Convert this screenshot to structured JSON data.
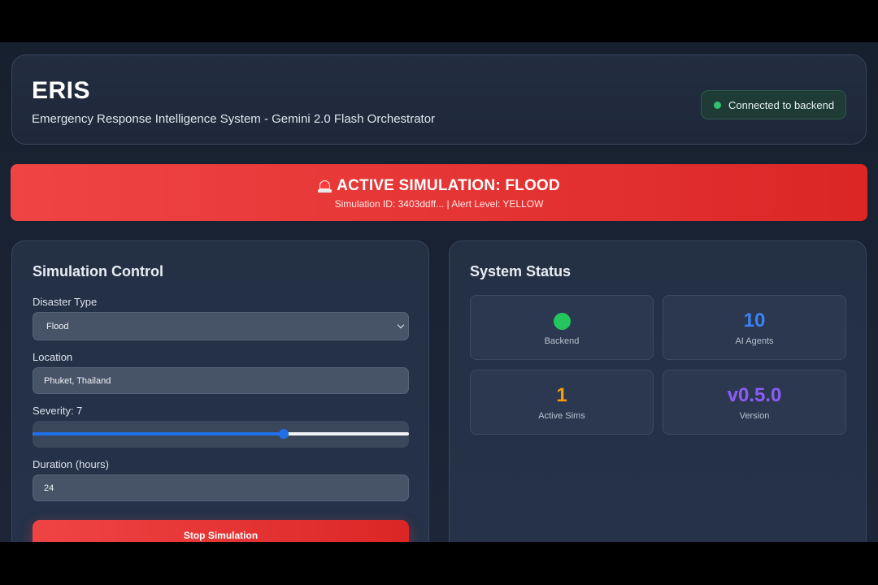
{
  "header": {
    "title": "ERIS",
    "subtitle": "Emergency Response Intelligence System - Gemini 2.0 Flash Orchestrator",
    "connection_status": "Connected to backend"
  },
  "alert": {
    "icon": "siren-icon",
    "title": "ACTIVE SIMULATION: FLOOD",
    "details": "Simulation ID: 3403ddff... | Alert Level: YELLOW"
  },
  "control": {
    "title": "Simulation Control",
    "disaster_type_label": "Disaster Type",
    "disaster_type_value": "Flood",
    "location_label": "Location",
    "location_value": "Phuket, Thailand",
    "severity_label": "Severity: 7",
    "severity_value": 7,
    "severity_min": 1,
    "severity_max": 10,
    "duration_label": "Duration (hours)",
    "duration_value": "24",
    "stop_button_label": "Stop Simulation"
  },
  "status": {
    "title": "System Status",
    "cards": [
      {
        "value": "",
        "label": "Backend",
        "indicator": "green-dot"
      },
      {
        "value": "10",
        "label": "AI Agents"
      },
      {
        "value": "1",
        "label": "Active Sims"
      },
      {
        "value": "v0.5.0",
        "label": "Version"
      }
    ]
  },
  "colors": {
    "accent_red": "#ef4444",
    "status_green": "#22c55e",
    "agents_blue": "#3b82f6",
    "sims_orange": "#f59e0b",
    "version_purple": "#8b5cf6"
  }
}
